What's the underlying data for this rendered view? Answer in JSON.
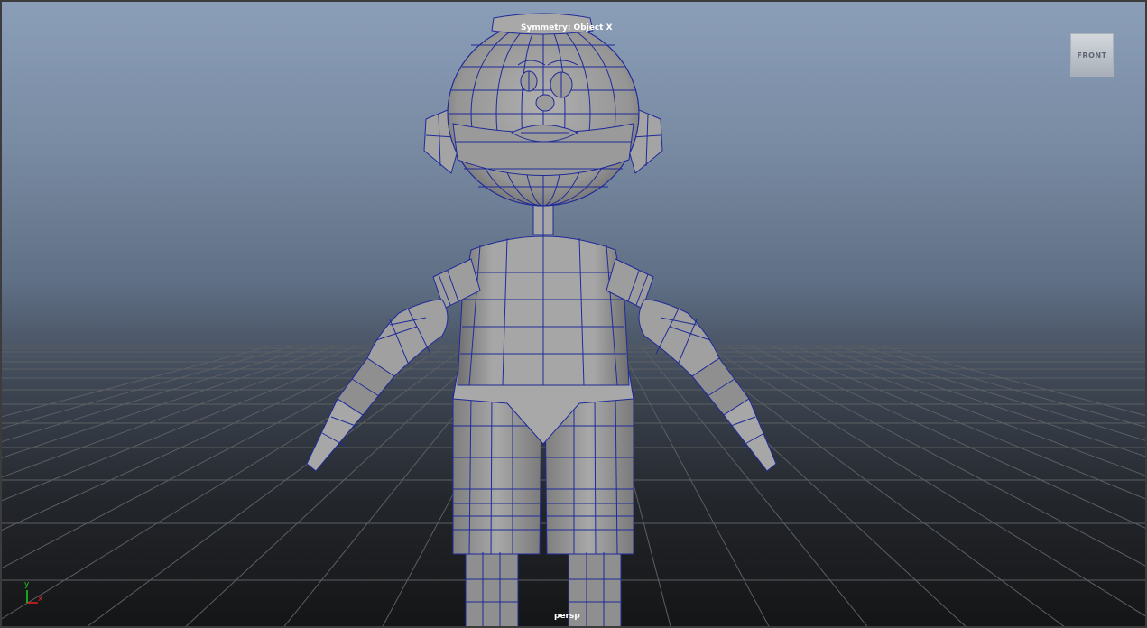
{
  "viewport": {
    "symmetry_label": "Symmetry: Object X",
    "camera_label": "persp",
    "view_cube_label": "FRONT",
    "axis": {
      "y": "y",
      "x": "x"
    }
  },
  "colors": {
    "wireframe": "#1f2a99",
    "mesh_fill": "#a3a3a3",
    "grid_line": "#606060",
    "axis_x": "#e02020",
    "axis_y": "#19d419"
  }
}
